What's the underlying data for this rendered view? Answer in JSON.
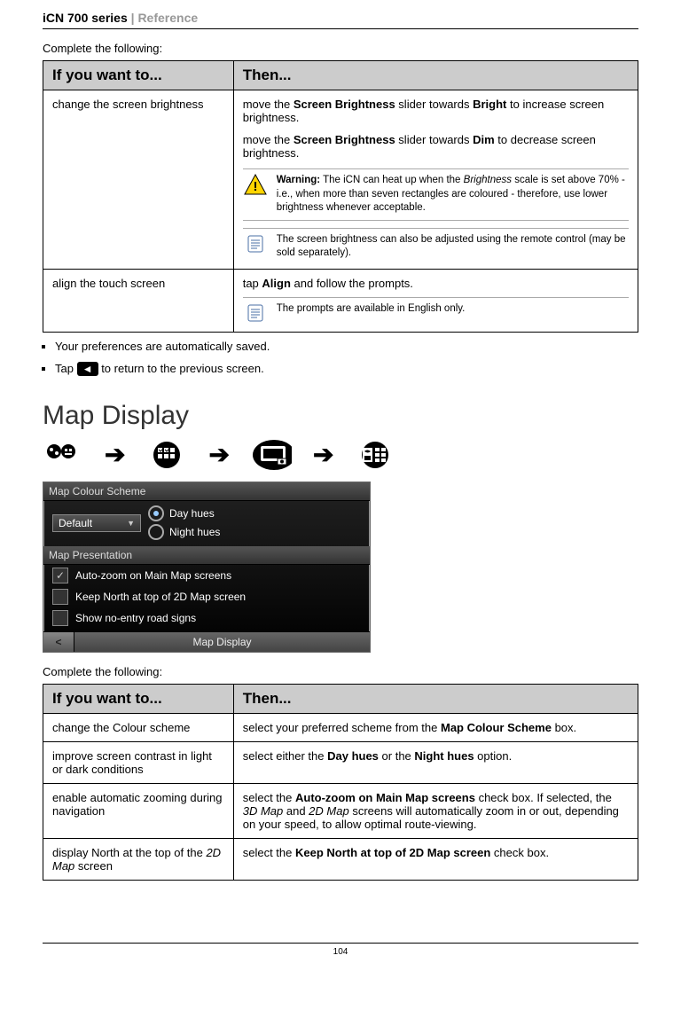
{
  "header": {
    "series": "iCN 700 series",
    "sep": "  |  ",
    "section": "Reference"
  },
  "intro1": "Complete the following:",
  "table1": {
    "h1": "If you want to...",
    "h2": "Then...",
    "r1c1": "change the screen brightness",
    "r1c2a_pre": "move the ",
    "r1c2a_b1": "Screen Brightness",
    "r1c2a_mid": " slider towards ",
    "r1c2a_b2": "Bright",
    "r1c2a_post": " to increase screen brightness.",
    "r1c2b_pre": "move the ",
    "r1c2b_b1": "Screen Brightness",
    "r1c2b_mid": " slider towards ",
    "r1c2b_b2": "Dim",
    "r1c2b_post": " to decrease screen brightness.",
    "warn_b": "Warning:",
    "warn_t1": " The iCN can heat up when the ",
    "warn_i": "Brightness",
    "warn_t2": " scale is set above 70% - i.e., when more than seven rectangles are coloured - therefore, use lower brightness whenever acceptable.",
    "note1": "The screen brightness can also be adjusted using the remote control (may be sold separately).",
    "r2c1": "align the touch screen",
    "r2c2_pre": "tap ",
    "r2c2_b": "Align",
    "r2c2_post": " and follow the prompts.",
    "note2": "The prompts are available in English only."
  },
  "bullets": {
    "b1": "Your preferences are automatically saved.",
    "b2a": "Tap ",
    "b2b": " to return to the previous screen."
  },
  "section_title": "Map Display",
  "shot": {
    "bar1": "Map Colour Scheme",
    "dd": "Default",
    "r1": "Day hues",
    "r2": "Night hues",
    "bar2": "Map Presentation",
    "c1": "Auto-zoom on Main Map screens",
    "c2": "Keep North at top of 2D Map screen",
    "c3": "Show no-entry road signs",
    "footer": "Map Display",
    "back": "<"
  },
  "intro2": "Complete the following:",
  "table2": {
    "h1": "If you want to...",
    "h2": "Then...",
    "r1c1": "change the Colour scheme",
    "r1c2_pre": "select your preferred scheme from the ",
    "r1c2_b": "Map Colour Scheme",
    "r1c2_post": " box.",
    "r2c1": "improve screen contrast in light or dark conditions",
    "r2c2_pre": "select either the ",
    "r2c2_b1": "Day hues",
    "r2c2_mid": " or the ",
    "r2c2_b2": "Night hues",
    "r2c2_post": " option.",
    "r3c1": "enable automatic zooming during navigation",
    "r3c2_pre": "select the ",
    "r3c2_b": "Auto-zoom on Main Map screens",
    "r3c2_mid": " check box. If selected, the ",
    "r3c2_i1": "3D Map",
    "r3c2_mid2": " and ",
    "r3c2_i2": "2D Map",
    "r3c2_post": " screens will automatically zoom in or out, depending on your speed, to allow optimal route-viewing.",
    "r4c1_pre": "display North at the top of the ",
    "r4c1_i": "2D Map",
    "r4c1_post": " screen",
    "r4c2_pre": "select the ",
    "r4c2_b": "Keep North at top of 2D Map screen",
    "r4c2_post": " check box."
  },
  "page_num": "104"
}
